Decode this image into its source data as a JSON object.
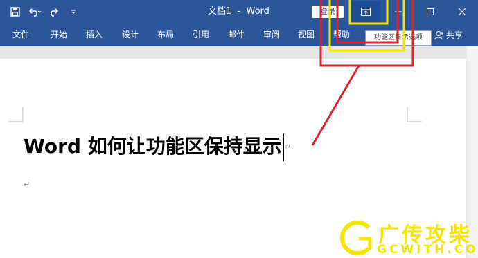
{
  "window": {
    "title": "文档1  -  Word",
    "login_label": "登录",
    "tooltip": "功能区显示选项"
  },
  "ribbon_tabs": [
    "文件",
    "开始",
    "插入",
    "设计",
    "布局",
    "引用",
    "邮件",
    "审阅",
    "视图",
    "帮助"
  ],
  "share_label": "共享",
  "document": {
    "heading": "Word 如何让功能区保持显示",
    "para_mark": "↵"
  },
  "watermark": {
    "text": "广传攻柴",
    "url": "GCWITH.COM"
  },
  "colors": {
    "accent": "#2b579a",
    "annotation_red": "#e0202a",
    "annotation_yellow": "#f5e600"
  },
  "icons": [
    "save-icon",
    "undo-icon",
    "redo-icon",
    "customize-qat-icon",
    "ribbon-display-options-icon",
    "minimize-icon",
    "maximize-icon",
    "close-icon",
    "share-person-icon"
  ]
}
